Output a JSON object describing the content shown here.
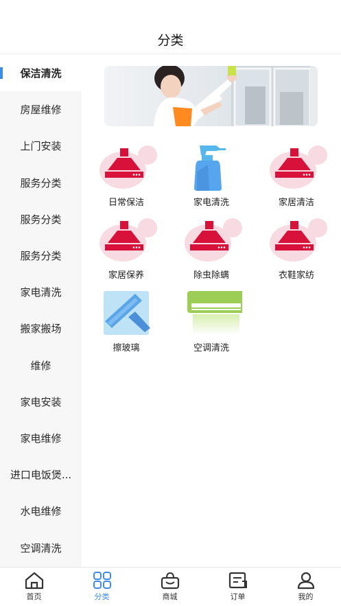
{
  "header": {
    "title": "分类"
  },
  "sidebar": {
    "items": [
      {
        "label": "保洁清洗",
        "active": true
      },
      {
        "label": "房屋维修"
      },
      {
        "label": "上门安装"
      },
      {
        "label": "服务分类"
      },
      {
        "label": "服务分类"
      },
      {
        "label": "服务分类"
      },
      {
        "label": "家电清洗"
      },
      {
        "label": "搬家搬场"
      },
      {
        "label": "维修"
      },
      {
        "label": "家电安装"
      },
      {
        "label": "家电维修"
      },
      {
        "label": "进口电饭煲..."
      },
      {
        "label": "水电维修"
      },
      {
        "label": "空调清洗"
      }
    ]
  },
  "main": {
    "categories": [
      {
        "label": "日常保洁",
        "icon": "range-hood-icon"
      },
      {
        "label": "家电清洗",
        "icon": "spray-bottle-icon"
      },
      {
        "label": "家居清洁",
        "icon": "range-hood-icon"
      },
      {
        "label": "家居保养",
        "icon": "range-hood-icon"
      },
      {
        "label": "除虫除螨",
        "icon": "range-hood-icon"
      },
      {
        "label": "衣鞋家纺",
        "icon": "range-hood-icon"
      },
      {
        "label": "擦玻璃",
        "icon": "squeegee-icon"
      },
      {
        "label": "空调清洗",
        "icon": "air-conditioner-icon"
      }
    ]
  },
  "tabbar": {
    "items": [
      {
        "label": "首页",
        "icon": "home-icon"
      },
      {
        "label": "分类",
        "icon": "grid-icon",
        "active": true
      },
      {
        "label": "商城",
        "icon": "shopping-bag-icon"
      },
      {
        "label": "订单",
        "icon": "order-icon"
      },
      {
        "label": "我的",
        "icon": "user-icon"
      }
    ]
  },
  "colors": {
    "accent": "#3d8ce8",
    "hood_red": "#d8113a",
    "hood_pink": "#f8dbe2"
  }
}
